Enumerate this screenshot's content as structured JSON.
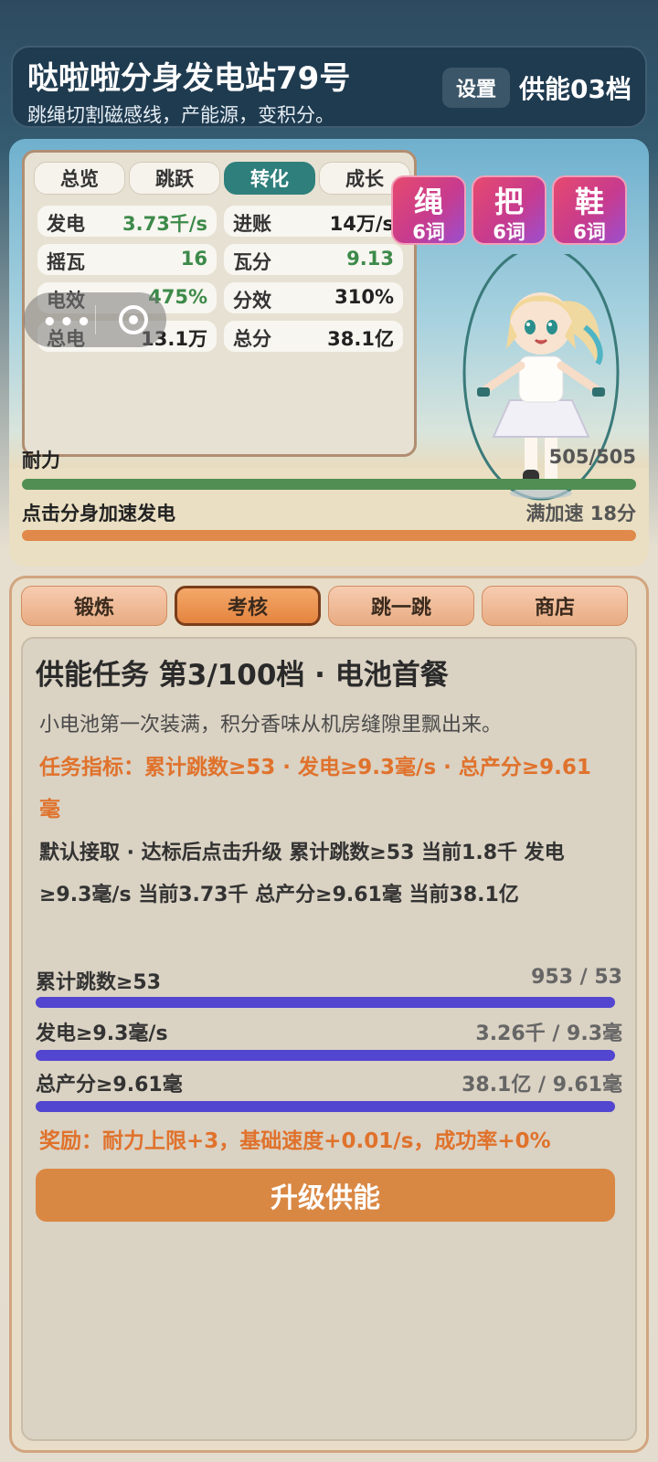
{
  "header": {
    "title": "哒啦啦分身发电站79号",
    "subtitle": "跳绳切割磁感线，产能源，变积分。",
    "settings_label": "设置",
    "level_label": "供能03档"
  },
  "stats": {
    "tabs": [
      "总览",
      "跳跃",
      "转化",
      "成长"
    ],
    "active_tab": "转化",
    "cells": [
      {
        "label": "发电",
        "value": "3.73千/s"
      },
      {
        "label": "进账",
        "value": "14万/s"
      },
      {
        "label": "摇瓦",
        "value": "16"
      },
      {
        "label": "瓦分",
        "value": "9.13"
      },
      {
        "label": "电效",
        "value": "475%"
      },
      {
        "label": "分效",
        "value": "310%"
      },
      {
        "label": "总电",
        "value": "13.1万"
      },
      {
        "label": "总分",
        "value": "38.1亿"
      }
    ]
  },
  "mini_widget": {
    "dots": "•••"
  },
  "badges": [
    {
      "char": "绳",
      "count": "6词"
    },
    {
      "char": "把",
      "count": "6词"
    },
    {
      "char": "鞋",
      "count": "6词"
    }
  ],
  "stamina": {
    "label": "耐力",
    "value": "505/505",
    "fill": 1.0
  },
  "boost": {
    "label": "点击分身加速发电",
    "value": "满加速 18分",
    "fill": 1.0
  },
  "nav_tabs": [
    "锻炼",
    "考核",
    "跳一跳",
    "商店"
  ],
  "active_nav": "考核",
  "task": {
    "title": "供能任务 第3/100档 · 电池首餐",
    "description": "小电池第一次装满，积分香味从机房缝隙里飘出来。",
    "target": "任务指标：累计跳数≥53 · 发电≥9.3毫/s · 总产分≥9.61毫",
    "status": "默认接取 · 达标后点击升级 累计跳数≥53 当前1.8千 发电≥9.3毫/s 当前3.73千 总产分≥9.61毫 当前38.1亿",
    "progress": [
      {
        "label": "累计跳数≥53",
        "value": "953 / 53",
        "fill": 1.0
      },
      {
        "label": "发电≥9.3毫/s",
        "value": "3.26千 / 9.3毫",
        "fill": 1.0
      },
      {
        "label": "总产分≥9.61毫",
        "value": "38.1亿 / 9.61毫",
        "fill": 1.0
      }
    ],
    "reward": "奖励：耐力上限+3，基础速度+0.01/s，成功率+0%",
    "upgrade_label": "升级供能"
  },
  "colors": {
    "header_bg": "#1f3b50",
    "tab_active": "#2f7f7c",
    "value_green": "#3d8a4a",
    "stamina_bar": "#508e53",
    "boost_bar": "#e0894a",
    "accent_orange": "#e0722c",
    "progress_bar": "#5245cf",
    "upgrade_button": "#d98844"
  }
}
